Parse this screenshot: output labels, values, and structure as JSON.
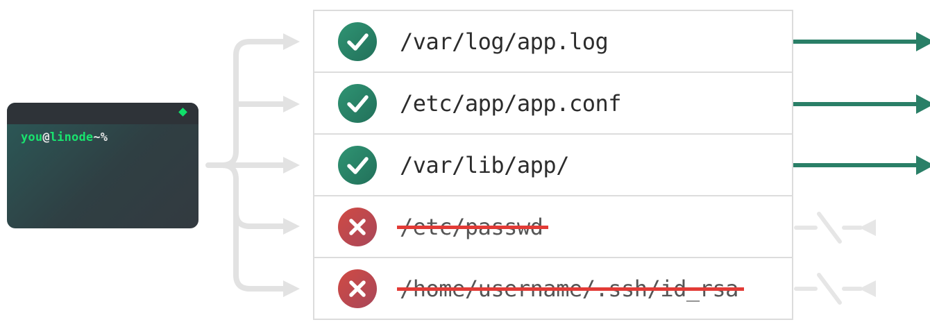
{
  "terminal": {
    "user": "you",
    "at": "@",
    "host": "linode",
    "suffix": "~%"
  },
  "files": [
    {
      "path": "/var/log/app.log",
      "status": "allowed"
    },
    {
      "path": "/etc/app/app.conf",
      "status": "allowed"
    },
    {
      "path": "/var/lib/app/",
      "status": "allowed"
    },
    {
      "path": "/etc/passwd",
      "status": "denied"
    },
    {
      "path": "/home/username/.ssh/id_rsa",
      "status": "denied"
    }
  ],
  "colors": {
    "allowed": "#2a7f67",
    "denied": "#c44747",
    "strike": "#e23b36",
    "wire": "#e2e2e2",
    "prompt": "#19e36e"
  },
  "icons": {
    "allowed": "check-icon",
    "denied": "x-icon"
  }
}
